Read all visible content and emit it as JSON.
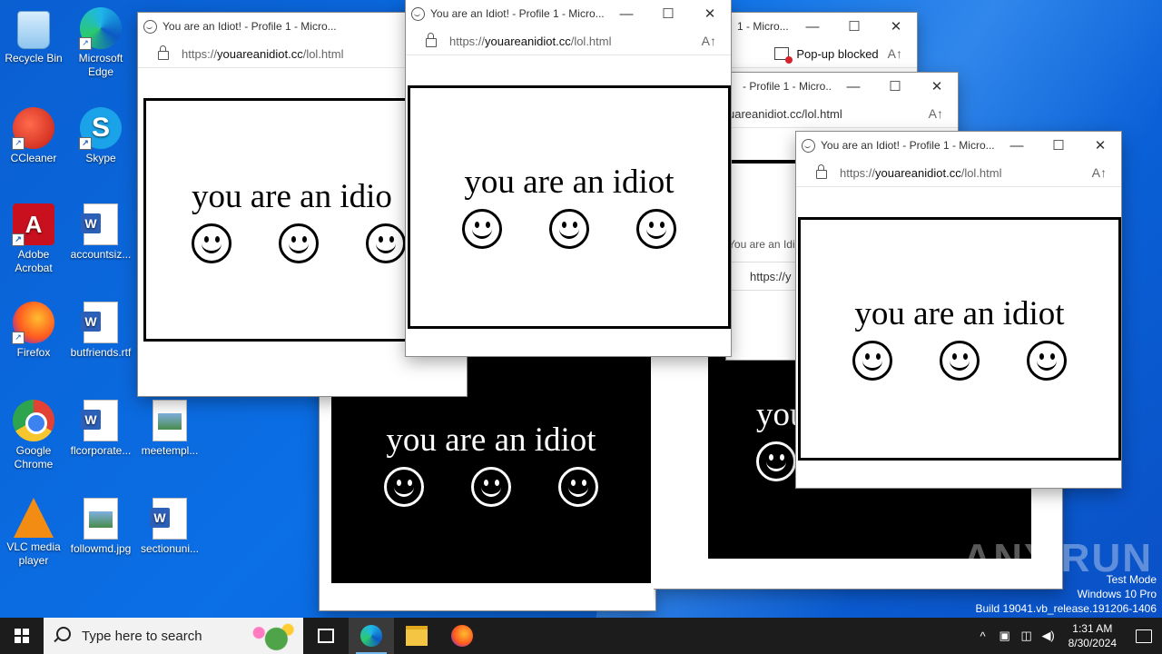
{
  "desktop_icons": [
    {
      "label": "Recycle Bin"
    },
    {
      "label": "Microsoft Edge"
    },
    {
      "label": "CCleaner"
    },
    {
      "label": "Skype"
    },
    {
      "label": "Adobe Acrobat"
    },
    {
      "label": "accountsiz..."
    },
    {
      "label": "Firefox"
    },
    {
      "label": "butfriends.rtf"
    },
    {
      "label": "Google Chrome"
    },
    {
      "label": "flcorporate..."
    },
    {
      "label": "meetempl..."
    },
    {
      "label": "VLC media player"
    },
    {
      "label": "followmd.jpg"
    },
    {
      "label": "sectionuni..."
    }
  ],
  "window": {
    "title_full": "You are an Idiot! - Profile 1 - Micro...",
    "title_short": "You are an Idiot! - Profile 1 - Micro...",
    "title_partial_a": "1 - Micro...",
    "title_partial_b": " - Profile 1 - Micro...",
    "url_domain": "youareanidiot.cc",
    "url_scheme": "https://",
    "url_path": "/lol.html",
    "url_partial": "uareanidiot.cc/lol.html",
    "url_partial_b": "https://y",
    "message": "you are an idiot",
    "message_partial": "you are an idio",
    "message_partial_b": "you",
    "message_partial_c": "You are an Idi",
    "popup_blocked": "Pop-up blocked",
    "read_aloud": "A↑",
    "minimize": "—",
    "maximize": "☐",
    "close": "✕"
  },
  "watermark": {
    "brand": "ANY.RUN",
    "line1": "Test Mode",
    "line2": "Windows 10 Pro",
    "line3": "Build 19041.vb_release.191206-1406"
  },
  "taskbar": {
    "search_placeholder": "Type here to search",
    "time": "1:31 AM",
    "date": "8/30/2024",
    "tray_icons": [
      "^",
      "▣",
      "◫",
      "◀)"
    ]
  }
}
